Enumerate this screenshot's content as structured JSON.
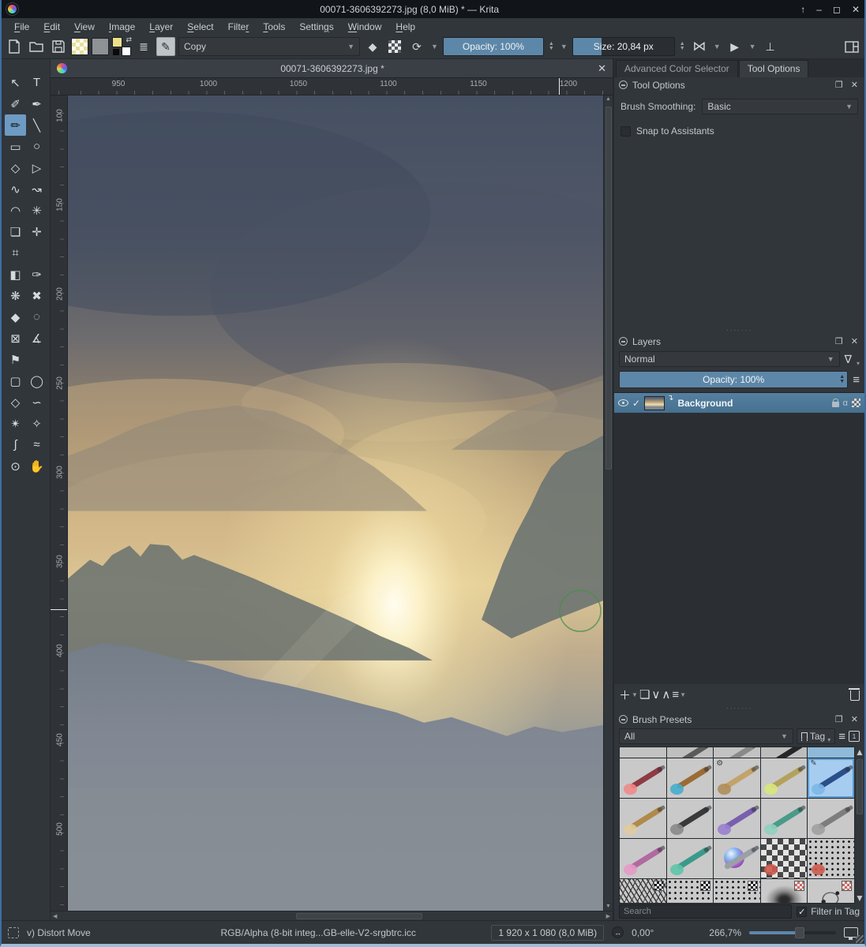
{
  "window": {
    "title": "00071-3606392273.jpg (8,0 MiB) * — Krita",
    "controls": {
      "keep_above": "↑",
      "minimize": "–",
      "maximize": "◻",
      "close": "✕"
    }
  },
  "menu": {
    "items": [
      {
        "label": "File",
        "u": 0
      },
      {
        "label": "Edit",
        "u": 0
      },
      {
        "label": "View",
        "u": 0
      },
      {
        "label": "Image",
        "u": 0
      },
      {
        "label": "Layer",
        "u": 0
      },
      {
        "label": "Select",
        "u": 0
      },
      {
        "label": "Filter",
        "u": 5
      },
      {
        "label": "Tools",
        "u": 0
      },
      {
        "label": "Settings",
        "u": 6
      },
      {
        "label": "Window",
        "u": 0
      },
      {
        "label": "Help",
        "u": 0
      }
    ]
  },
  "toolbar": {
    "blend_mode": "Copy",
    "opacity_label": "Opacity: 100%",
    "opacity_fill_percent": 100,
    "size_label": "Size: 20,84 px",
    "size_fill_percent": 28
  },
  "toolbox": {
    "tools": [
      {
        "name": "select-shapes-tool",
        "glyph": "↖"
      },
      {
        "name": "text-tool",
        "glyph": "T"
      },
      {
        "name": "edit-shapes-tool",
        "glyph": "✐"
      },
      {
        "name": "calligraphy-tool",
        "glyph": "✒"
      },
      {
        "name": "freehand-brush-tool",
        "glyph": "✏",
        "active": true
      },
      {
        "name": "line-tool",
        "glyph": "╲"
      },
      {
        "name": "rectangle-tool",
        "glyph": "▭"
      },
      {
        "name": "ellipse-tool",
        "glyph": "○"
      },
      {
        "name": "polygon-tool",
        "glyph": "◇"
      },
      {
        "name": "polyline-tool",
        "glyph": "▷"
      },
      {
        "name": "bezier-curve-tool",
        "glyph": "∿"
      },
      {
        "name": "freehand-path-tool",
        "glyph": "↝"
      },
      {
        "name": "dynamic-brush-tool",
        "glyph": "◠"
      },
      {
        "name": "multibrush-tool",
        "glyph": "✳"
      },
      {
        "name": "transform-tool",
        "glyph": "❏"
      },
      {
        "name": "move-tool",
        "glyph": "✛"
      },
      {
        "name": "crop-tool",
        "glyph": "⌗"
      },
      {
        "name": "empty",
        "glyph": "",
        "empty": true
      },
      {
        "name": "gradient-tool",
        "glyph": "◧"
      },
      {
        "name": "color-sampler-tool",
        "glyph": "✑"
      },
      {
        "name": "pattern-edit-tool",
        "glyph": "❋"
      },
      {
        "name": "smart-patch-tool",
        "glyph": "✖"
      },
      {
        "name": "fill-tool",
        "glyph": "◆"
      },
      {
        "name": "enclose-fill-tool",
        "glyph": "◌"
      },
      {
        "name": "colorize-mask-tool",
        "glyph": "⊠"
      },
      {
        "name": "measure-tool",
        "glyph": "∡"
      },
      {
        "name": "reference-images-tool",
        "glyph": "⚑"
      },
      {
        "name": "empty2",
        "glyph": "",
        "empty": true
      },
      {
        "name": "rectangular-selection-tool",
        "glyph": "▢"
      },
      {
        "name": "elliptical-selection-tool",
        "glyph": "◯"
      },
      {
        "name": "polygonal-selection-tool",
        "glyph": "◇"
      },
      {
        "name": "freehand-selection-tool",
        "glyph": "∽"
      },
      {
        "name": "similar-selection-tool",
        "glyph": "✴"
      },
      {
        "name": "select-by-color-tool",
        "glyph": "✧"
      },
      {
        "name": "bezier-selection-tool",
        "glyph": "∫"
      },
      {
        "name": "magnetic-selection-tool",
        "glyph": "≈"
      },
      {
        "name": "zoom-tool",
        "glyph": "⊙"
      },
      {
        "name": "pan-tool",
        "glyph": "✋"
      }
    ]
  },
  "document": {
    "tab_title": "00071-3606392273.jpg *",
    "close": "✕"
  },
  "rulers": {
    "horizontal": [
      "950",
      "1000",
      "1050",
      "1100",
      "1150",
      "1200"
    ],
    "vertical": [
      "100",
      "150",
      "200",
      "250",
      "300",
      "350",
      "400",
      "450",
      "500"
    ]
  },
  "dockers": {
    "tabs": [
      {
        "label": "Advanced Color Selector",
        "active": false
      },
      {
        "label": "Tool Options",
        "active": true
      }
    ],
    "tool_options": {
      "title": "Tool Options",
      "brush_smoothing_label": "Brush Smoothing:",
      "brush_smoothing_value": "Basic",
      "snap_label": "Snap to Assistants",
      "snap_checked": false
    },
    "layers": {
      "title": "Layers",
      "blend_mode": "Normal",
      "opacity_label": "Opacity:  100%",
      "layer": {
        "name": "Background",
        "visible": true,
        "checked": "✓",
        "alpha_label": "α"
      }
    },
    "brush_presets": {
      "title": "Brush Presets",
      "tag_filter": "All",
      "tag_button_label": "Tag",
      "search_placeholder": "Search",
      "filter_in_tag_label": "Filter in Tag",
      "filter_in_tag_checked": true,
      "cells": [
        {
          "name": "preset-partial-1",
          "bg": "#c2c2c2"
        },
        {
          "name": "preset-partial-2",
          "bg": "#bfbfbf",
          "stroke": "#5a5a5a"
        },
        {
          "name": "preset-partial-3",
          "bg": "#c2c2c2",
          "stroke": "#8a8a8a"
        },
        {
          "name": "preset-partial-4",
          "bg": "#bdbdbd",
          "stroke": "#262626"
        },
        {
          "name": "preset-partial-5",
          "bg": "#8fb9d8"
        },
        {
          "name": "preset-stamp-red",
          "stroke": "#8e3b44",
          "blob": "#f08a8a"
        },
        {
          "name": "preset-stamp-gold",
          "stroke": "#9a6b35",
          "blob": "#46aecc"
        },
        {
          "name": "preset-chalk",
          "stroke": "#c2a36b",
          "blob": "#b08d5a",
          "mark": "⚙"
        },
        {
          "name": "preset-stamp-ring",
          "stroke": "#b4a15c",
          "blob": "#d7e77a"
        },
        {
          "name": "preset-selected-blue",
          "bg": "#a6cdf0",
          "stroke": "#2a4f8a",
          "blob": "#7db8e8",
          "selected": true,
          "mark": "✎"
        },
        {
          "name": "preset-flower-pen",
          "stroke": "#b08a4a",
          "blob": "#e0cb9e"
        },
        {
          "name": "preset-ink-scribble",
          "stroke": "#3a3a3a",
          "blob": "#8a8a8a"
        },
        {
          "name": "preset-marker-purple",
          "stroke": "#7a5fae",
          "blob": "#9a7fd0"
        },
        {
          "name": "preset-marker-teal",
          "stroke": "#4a9a8a",
          "blob": "#8fd0c0"
        },
        {
          "name": "preset-pencil-sketch",
          "stroke": "#7d7d7d",
          "blob": "#a0a0a0"
        },
        {
          "name": "preset-pencils-pink",
          "stroke": "#b06aa0",
          "blob": "#e59ac6"
        },
        {
          "name": "preset-brush-teal-flowers",
          "stroke": "#3a9a8a",
          "blob": "#5ec4a8"
        },
        {
          "name": "preset-airbrush-sphere",
          "stroke": "#9aa0a4",
          "texture": "ball"
        },
        {
          "name": "preset-transparency-checker",
          "texture": "checker",
          "blob": "#cf5a4e"
        },
        {
          "name": "preset-halftone-checker",
          "texture": "dots",
          "blob": "#cf5a4e"
        },
        {
          "name": "preset-hatch-texture",
          "texture": "hatch",
          "badge": "bw"
        },
        {
          "name": "preset-halftone-gradient",
          "texture": "dots",
          "badge": "bw"
        },
        {
          "name": "preset-halftone-diagonal",
          "texture": "dots",
          "badge": "bw"
        },
        {
          "name": "preset-charcoal-smudge",
          "texture": "smudge",
          "badge": "red"
        },
        {
          "name": "preset-ink-splatter",
          "texture": "splat",
          "badge": "red"
        }
      ]
    }
  },
  "statusbar": {
    "tool_hint": "v) Distort Move",
    "color_profile": "RGB/Alpha (8-bit integ...GB-elle-V2-srgbtrc.icc",
    "doc_size": "1 920 x 1 080 (8,0 MiB)",
    "rotation": "0,00°",
    "zoom": "266,7%"
  },
  "colors": {
    "accent_blue": "#5d87a8",
    "tool_active_blue": "#6d9bc3",
    "panel_bg": "#31363b",
    "dark_bg": "#2a2e32",
    "titlebar_bg": "#111519",
    "selected_layer": "#4d7594",
    "preset_selected_bg": "#a6cdf0",
    "window_border": "#3d6fa0"
  }
}
